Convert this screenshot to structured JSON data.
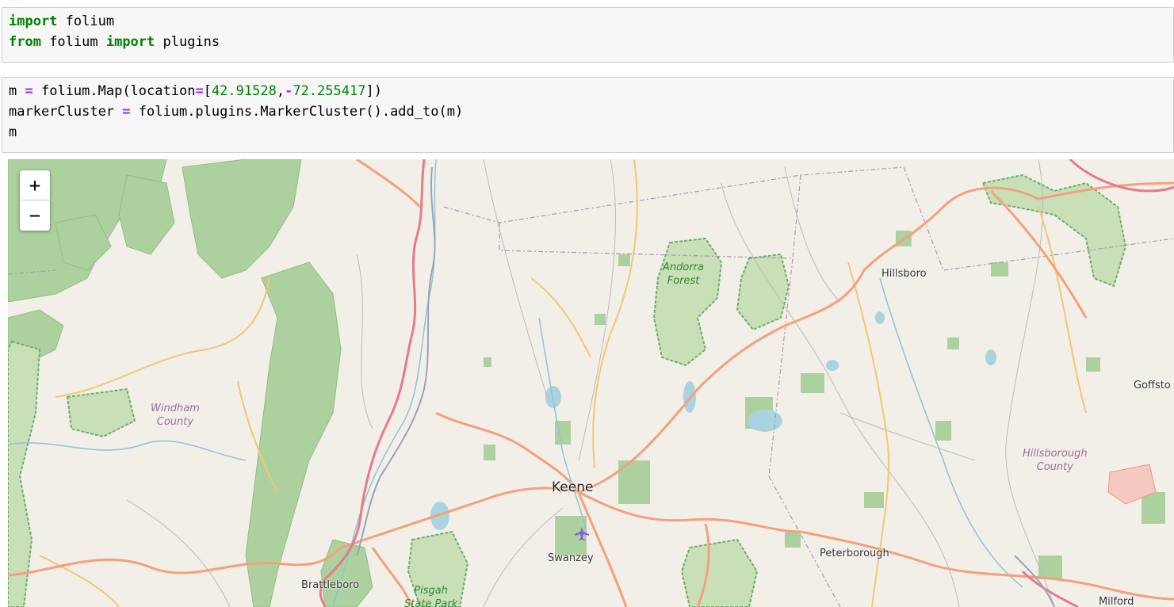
{
  "cells": [
    {
      "lines": [
        [
          {
            "t": "import",
            "c": "kw"
          },
          {
            "t": " folium",
            "c": ""
          }
        ],
        [
          {
            "t": "from",
            "c": "kw"
          },
          {
            "t": " folium ",
            "c": ""
          },
          {
            "t": "import",
            "c": "kw"
          },
          {
            "t": " plugins",
            "c": ""
          }
        ]
      ]
    },
    {
      "lines": [
        [
          {
            "t": "m ",
            "c": ""
          },
          {
            "t": "=",
            "c": "op"
          },
          {
            "t": " folium.Map(location",
            "c": ""
          },
          {
            "t": "=",
            "c": "op"
          },
          {
            "t": "[",
            "c": ""
          },
          {
            "t": "42.91528",
            "c": "num"
          },
          {
            "t": ",",
            "c": ""
          },
          {
            "t": "-",
            "c": "op"
          },
          {
            "t": "72.255417",
            "c": "num"
          },
          {
            "t": "])",
            "c": ""
          }
        ],
        [
          {
            "t": "markerCluster ",
            "c": ""
          },
          {
            "t": "=",
            "c": "op"
          },
          {
            "t": " folium.plugins.MarkerCluster().add_to(m)",
            "c": ""
          }
        ],
        [
          {
            "t": "m",
            "c": ""
          }
        ]
      ]
    }
  ],
  "map": {
    "zoom_in": "+",
    "zoom_out": "−",
    "labels": {
      "keene": "Keene",
      "hillsboro": "Hillsboro",
      "goffstown": "Goffsto",
      "swanzey": "Swanzey",
      "peterborough": "Peterborough",
      "brattleboro": "Brattleboro",
      "milford": "Milford",
      "windham_1": "Windham",
      "windham_2": "County",
      "hillsborough_1": "Hillsborough",
      "hillsborough_2": "County",
      "andorra_1": "Andorra",
      "andorra_2": "Forest",
      "pisgah_1": "Pisgah",
      "pisgah_2": "State Park"
    },
    "colors": {
      "land": "#f2efe9",
      "forest": "#add19e",
      "park_border": "#6ab06a",
      "major_road": "#f3a17a",
      "trunk_road": "#e8798c",
      "secondary_road": "#f6c571",
      "minor_road": "#b8b8b8",
      "water": "#aad3df",
      "boundary": "#b494b4",
      "airport": "#8a5fd0"
    },
    "icons": [
      "airport-icon"
    ]
  }
}
